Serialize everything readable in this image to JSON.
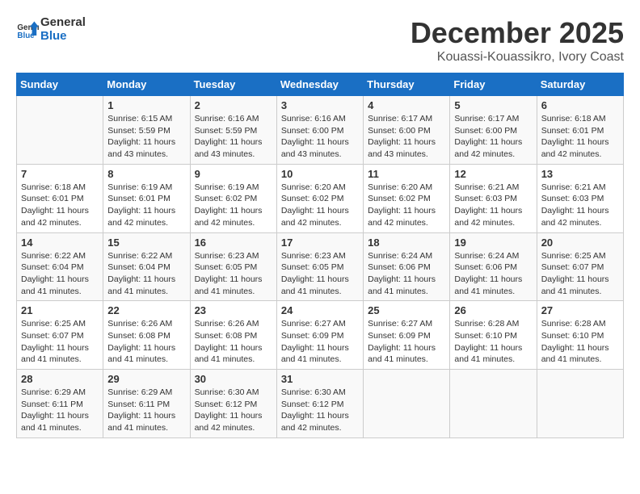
{
  "header": {
    "logo_general": "General",
    "logo_blue": "Blue",
    "month_year": "December 2025",
    "location": "Kouassi-Kouassikro, Ivory Coast"
  },
  "weekdays": [
    "Sunday",
    "Monday",
    "Tuesday",
    "Wednesday",
    "Thursday",
    "Friday",
    "Saturday"
  ],
  "weeks": [
    [
      {
        "day": "",
        "sunrise": "",
        "sunset": "",
        "daylight": ""
      },
      {
        "day": "1",
        "sunrise": "Sunrise: 6:15 AM",
        "sunset": "Sunset: 5:59 PM",
        "daylight": "Daylight: 11 hours and 43 minutes."
      },
      {
        "day": "2",
        "sunrise": "Sunrise: 6:16 AM",
        "sunset": "Sunset: 5:59 PM",
        "daylight": "Daylight: 11 hours and 43 minutes."
      },
      {
        "day": "3",
        "sunrise": "Sunrise: 6:16 AM",
        "sunset": "Sunset: 6:00 PM",
        "daylight": "Daylight: 11 hours and 43 minutes."
      },
      {
        "day": "4",
        "sunrise": "Sunrise: 6:17 AM",
        "sunset": "Sunset: 6:00 PM",
        "daylight": "Daylight: 11 hours and 43 minutes."
      },
      {
        "day": "5",
        "sunrise": "Sunrise: 6:17 AM",
        "sunset": "Sunset: 6:00 PM",
        "daylight": "Daylight: 11 hours and 42 minutes."
      },
      {
        "day": "6",
        "sunrise": "Sunrise: 6:18 AM",
        "sunset": "Sunset: 6:01 PM",
        "daylight": "Daylight: 11 hours and 42 minutes."
      }
    ],
    [
      {
        "day": "7",
        "sunrise": "Sunrise: 6:18 AM",
        "sunset": "Sunset: 6:01 PM",
        "daylight": "Daylight: 11 hours and 42 minutes."
      },
      {
        "day": "8",
        "sunrise": "Sunrise: 6:19 AM",
        "sunset": "Sunset: 6:01 PM",
        "daylight": "Daylight: 11 hours and 42 minutes."
      },
      {
        "day": "9",
        "sunrise": "Sunrise: 6:19 AM",
        "sunset": "Sunset: 6:02 PM",
        "daylight": "Daylight: 11 hours and 42 minutes."
      },
      {
        "day": "10",
        "sunrise": "Sunrise: 6:20 AM",
        "sunset": "Sunset: 6:02 PM",
        "daylight": "Daylight: 11 hours and 42 minutes."
      },
      {
        "day": "11",
        "sunrise": "Sunrise: 6:20 AM",
        "sunset": "Sunset: 6:02 PM",
        "daylight": "Daylight: 11 hours and 42 minutes."
      },
      {
        "day": "12",
        "sunrise": "Sunrise: 6:21 AM",
        "sunset": "Sunset: 6:03 PM",
        "daylight": "Daylight: 11 hours and 42 minutes."
      },
      {
        "day": "13",
        "sunrise": "Sunrise: 6:21 AM",
        "sunset": "Sunset: 6:03 PM",
        "daylight": "Daylight: 11 hours and 42 minutes."
      }
    ],
    [
      {
        "day": "14",
        "sunrise": "Sunrise: 6:22 AM",
        "sunset": "Sunset: 6:04 PM",
        "daylight": "Daylight: 11 hours and 41 minutes."
      },
      {
        "day": "15",
        "sunrise": "Sunrise: 6:22 AM",
        "sunset": "Sunset: 6:04 PM",
        "daylight": "Daylight: 11 hours and 41 minutes."
      },
      {
        "day": "16",
        "sunrise": "Sunrise: 6:23 AM",
        "sunset": "Sunset: 6:05 PM",
        "daylight": "Daylight: 11 hours and 41 minutes."
      },
      {
        "day": "17",
        "sunrise": "Sunrise: 6:23 AM",
        "sunset": "Sunset: 6:05 PM",
        "daylight": "Daylight: 11 hours and 41 minutes."
      },
      {
        "day": "18",
        "sunrise": "Sunrise: 6:24 AM",
        "sunset": "Sunset: 6:06 PM",
        "daylight": "Daylight: 11 hours and 41 minutes."
      },
      {
        "day": "19",
        "sunrise": "Sunrise: 6:24 AM",
        "sunset": "Sunset: 6:06 PM",
        "daylight": "Daylight: 11 hours and 41 minutes."
      },
      {
        "day": "20",
        "sunrise": "Sunrise: 6:25 AM",
        "sunset": "Sunset: 6:07 PM",
        "daylight": "Daylight: 11 hours and 41 minutes."
      }
    ],
    [
      {
        "day": "21",
        "sunrise": "Sunrise: 6:25 AM",
        "sunset": "Sunset: 6:07 PM",
        "daylight": "Daylight: 11 hours and 41 minutes."
      },
      {
        "day": "22",
        "sunrise": "Sunrise: 6:26 AM",
        "sunset": "Sunset: 6:08 PM",
        "daylight": "Daylight: 11 hours and 41 minutes."
      },
      {
        "day": "23",
        "sunrise": "Sunrise: 6:26 AM",
        "sunset": "Sunset: 6:08 PM",
        "daylight": "Daylight: 11 hours and 41 minutes."
      },
      {
        "day": "24",
        "sunrise": "Sunrise: 6:27 AM",
        "sunset": "Sunset: 6:09 PM",
        "daylight": "Daylight: 11 hours and 41 minutes."
      },
      {
        "day": "25",
        "sunrise": "Sunrise: 6:27 AM",
        "sunset": "Sunset: 6:09 PM",
        "daylight": "Daylight: 11 hours and 41 minutes."
      },
      {
        "day": "26",
        "sunrise": "Sunrise: 6:28 AM",
        "sunset": "Sunset: 6:10 PM",
        "daylight": "Daylight: 11 hours and 41 minutes."
      },
      {
        "day": "27",
        "sunrise": "Sunrise: 6:28 AM",
        "sunset": "Sunset: 6:10 PM",
        "daylight": "Daylight: 11 hours and 41 minutes."
      }
    ],
    [
      {
        "day": "28",
        "sunrise": "Sunrise: 6:29 AM",
        "sunset": "Sunset: 6:11 PM",
        "daylight": "Daylight: 11 hours and 41 minutes."
      },
      {
        "day": "29",
        "sunrise": "Sunrise: 6:29 AM",
        "sunset": "Sunset: 6:11 PM",
        "daylight": "Daylight: 11 hours and 41 minutes."
      },
      {
        "day": "30",
        "sunrise": "Sunrise: 6:30 AM",
        "sunset": "Sunset: 6:12 PM",
        "daylight": "Daylight: 11 hours and 42 minutes."
      },
      {
        "day": "31",
        "sunrise": "Sunrise: 6:30 AM",
        "sunset": "Sunset: 6:12 PM",
        "daylight": "Daylight: 11 hours and 42 minutes."
      },
      {
        "day": "",
        "sunrise": "",
        "sunset": "",
        "daylight": ""
      },
      {
        "day": "",
        "sunrise": "",
        "sunset": "",
        "daylight": ""
      },
      {
        "day": "",
        "sunrise": "",
        "sunset": "",
        "daylight": ""
      }
    ]
  ]
}
